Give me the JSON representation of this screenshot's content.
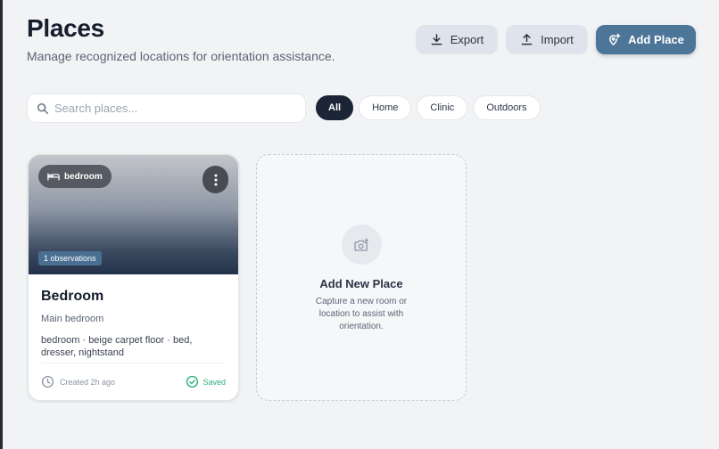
{
  "header": {
    "title": "Places",
    "subtitle": "Manage recognized locations for orientation assistance."
  },
  "actions": {
    "export_label": "Export",
    "import_label": "Import",
    "add_label": "Add Place"
  },
  "search": {
    "placeholder": "Search places...",
    "value": ""
  },
  "filters": [
    {
      "label": "All",
      "active": true
    },
    {
      "label": "Home",
      "active": false
    },
    {
      "label": "Clinic",
      "active": false
    },
    {
      "label": "Outdoors",
      "active": false
    }
  ],
  "places": [
    {
      "tag": "bedroom",
      "tag_icon": "bed-icon",
      "observations": "1 observations",
      "name": "Bedroom",
      "subtitle": "Main bedroom",
      "description": "bedroom · beige carpet floor · bed, dresser, nightstand",
      "created": "Created 2h ago",
      "status": "Saved"
    }
  ],
  "add_card": {
    "title": "Add New Place",
    "description": "Capture a new room or location to assist with orientation.",
    "icon": "camera-plus-icon"
  },
  "colors": {
    "primary": "#4c7598",
    "chip_active": "#1c2537",
    "saved": "#2fae7a",
    "background": "#f2f3f5"
  }
}
